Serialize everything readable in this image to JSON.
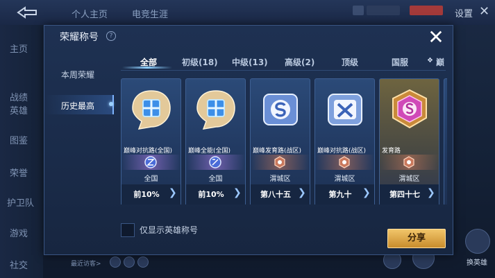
{
  "background": {
    "top_tabs": [
      "个人主页",
      "电竞生涯"
    ],
    "settings_label": "设置",
    "side_items": [
      "主页",
      "战绩",
      "英雄",
      "图鉴",
      "荣誉",
      "护卫队",
      "游戏",
      "社交"
    ],
    "visitors_label": "最近访客>",
    "right_label": "换英雄"
  },
  "modal": {
    "title": "荣耀称号",
    "help_glyph": "?",
    "close_glyph": "✕",
    "nav": [
      {
        "label": "本周荣耀",
        "active": false
      },
      {
        "label": "历史最高",
        "active": true
      }
    ],
    "tabs": [
      {
        "label": "全部",
        "active": true
      },
      {
        "label": "初级(18)",
        "active": false
      },
      {
        "label": "中级(13)",
        "active": false
      },
      {
        "label": "高级(2)",
        "active": false
      },
      {
        "label": "顶级",
        "active": false
      },
      {
        "label": "国服",
        "active": false
      },
      {
        "label": "巅",
        "active": false
      }
    ],
    "cards": [
      {
        "title": "巅峰对抗路(全国)",
        "region": "全国",
        "rank": "前10%",
        "style": "blue",
        "icon": "crossed-cube-icon"
      },
      {
        "title": "巅峰全能(全国)",
        "region": "全国",
        "rank": "前10%",
        "style": "blue",
        "icon": "crossed-cube-icon"
      },
      {
        "title": "巅峰发育路(战区)",
        "region": "渭城区",
        "rank": "第八十五",
        "style": "blue",
        "icon": "s-emblem-icon"
      },
      {
        "title": "巅峰对抗路(战区)",
        "region": "渭城区",
        "rank": "第九十",
        "style": "blue",
        "icon": "x-emblem-icon"
      },
      {
        "title": "发育路",
        "region": "渭城区",
        "rank": "第四十七",
        "style": "gold",
        "icon": "pink-s-emblem-icon"
      }
    ],
    "checkbox_label": "仅显示英雄称号",
    "share_label": "分享",
    "arrow_glyph": "❯"
  },
  "colors": {
    "accent_gold": "#d9a64a",
    "accent_blue": "#8fd0ff"
  }
}
